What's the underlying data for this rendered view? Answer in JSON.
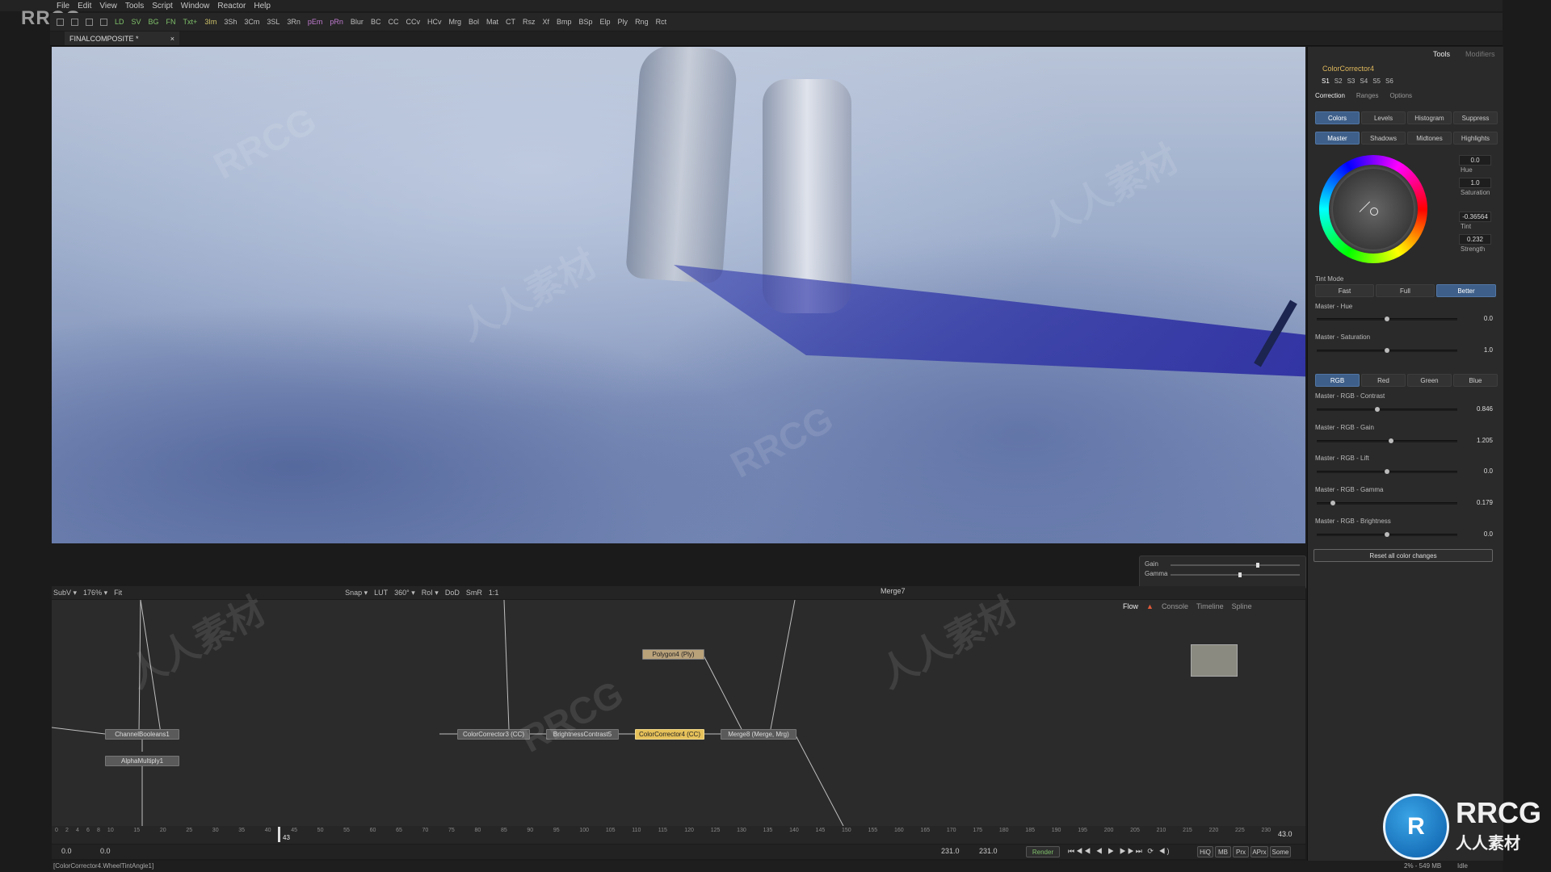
{
  "watermark": {
    "corner_logo": "RRCG",
    "diag_text_1": "RRCG",
    "diag_text_2": "人人素材",
    "brand_title": "RRCG",
    "brand_sub": "人人素材"
  },
  "menu": [
    "File",
    "Edit",
    "View",
    "Tools",
    "Script",
    "Window",
    "Reactor",
    "Help"
  ],
  "toolbar": [
    "LD",
    "SV",
    "BG",
    "FN",
    "Txt+",
    "3Im",
    "3Sh",
    "3Cm",
    "3SL",
    "3Rn",
    "pEm",
    "pRn",
    "Blur",
    "BC",
    "CC",
    "CCv",
    "HCv",
    "Mrg",
    "Bol",
    "Mat",
    "CT",
    "Rsz",
    "Xf",
    "Bmp",
    "BSp",
    "Elp",
    "Ply",
    "Rng",
    "Rct"
  ],
  "document_tab": {
    "title": "FINALCOMPOSITE *",
    "close": "×"
  },
  "viewer": {
    "gain_label": "Gain",
    "gamma_label": "Gamma",
    "gain_level": 0.68,
    "gamma_level": 0.54,
    "toolbar": [
      "SubV ▾",
      "176% ▾",
      "Fit",
      "Snap ▾",
      "LUT",
      "360° ▾",
      "RoI ▾",
      "DoD",
      "SmR",
      "1:1"
    ],
    "node_name": "Merge7"
  },
  "flow": {
    "tabs": [
      "Flow",
      "Console",
      "Timeline",
      "Spline"
    ],
    "active_tab": "Flow",
    "nodes": {
      "channel_booleans": "ChannelBooleans1",
      "alpha_multiply": "AlphaMultiply1",
      "color_corrector3": "ColorCorrector3 (CC)",
      "brightness_contrast": "BrightnessContrast5",
      "color_corrector4": "ColorCorrector4 (CC)",
      "merge": "Merge8 (Merge, Mrg)",
      "polygon": "Polygon4 (Ply)"
    }
  },
  "timeline": {
    "ticks": [
      "0",
      "2",
      "4",
      "6",
      "8",
      "10",
      "15",
      "20",
      "25",
      "30",
      "35",
      "40",
      "45",
      "50",
      "55",
      "60",
      "65",
      "70",
      "75",
      "80",
      "85",
      "90",
      "95",
      "100",
      "105",
      "110",
      "115",
      "120",
      "125",
      "130",
      "135",
      "140",
      "145",
      "150",
      "155",
      "160",
      "165",
      "170",
      "175",
      "180",
      "185",
      "190",
      "195",
      "200",
      "205",
      "210",
      "215",
      "220",
      "225",
      "230"
    ],
    "playhead": "43",
    "current": "43.0",
    "start": "0.0",
    "render_start": "0.0",
    "render_end": "231.0",
    "end": "231.0",
    "render_label": "Render",
    "buttons": [
      "HiQ",
      "MB",
      "Prx",
      "APrx",
      "Some"
    ]
  },
  "status": {
    "left": "[ColorCorrector4.WheelTintAngle1]",
    "memory": "2% - 549 MB",
    "state": "Idle"
  },
  "inspector": {
    "tabs": [
      "Tools",
      "Modifiers"
    ],
    "tool_name": "ColorCorrector4",
    "slots": [
      "S1",
      "S2",
      "S3",
      "S4",
      "S5",
      "S6"
    ],
    "section_tabs": [
      "Correction",
      "Ranges",
      "Options"
    ],
    "mode_tabs": [
      "Colors",
      "Levels",
      "Histogram",
      "Suppress"
    ],
    "range_tabs": [
      "Master",
      "Shadows",
      "Midtones",
      "Highlights"
    ],
    "hue_value": "0.0",
    "hue_label": "Hue",
    "sat_value": "1.0",
    "sat_label": "Saturation",
    "tint_value": "-0.36564",
    "tint_label": "Tint",
    "strength_value": "0.232",
    "strength_label": "Strength",
    "tint_mode_label": "Tint Mode",
    "tint_modes": [
      "Fast",
      "Full",
      "Better"
    ],
    "channel_tabs": [
      "RGB",
      "Red",
      "Green",
      "Blue"
    ],
    "sliders": [
      {
        "label": "Master - Hue",
        "value": "0.0",
        "pos": 0.5
      },
      {
        "label": "Master - Saturation",
        "value": "1.0",
        "pos": 0.5
      },
      {
        "label": "Master - RGB - Contrast",
        "value": "0.846",
        "pos": 0.43
      },
      {
        "label": "Master - RGB - Gain",
        "value": "1.205",
        "pos": 0.53
      },
      {
        "label": "Master - RGB - Lift",
        "value": "0.0",
        "pos": 0.5
      },
      {
        "label": "Master - RGB - Gamma",
        "value": "0.179",
        "pos": 0.1
      },
      {
        "label": "Master - RGB - Brightness",
        "value": "0.0",
        "pos": 0.5
      }
    ],
    "reset_label": "Reset all color changes"
  }
}
